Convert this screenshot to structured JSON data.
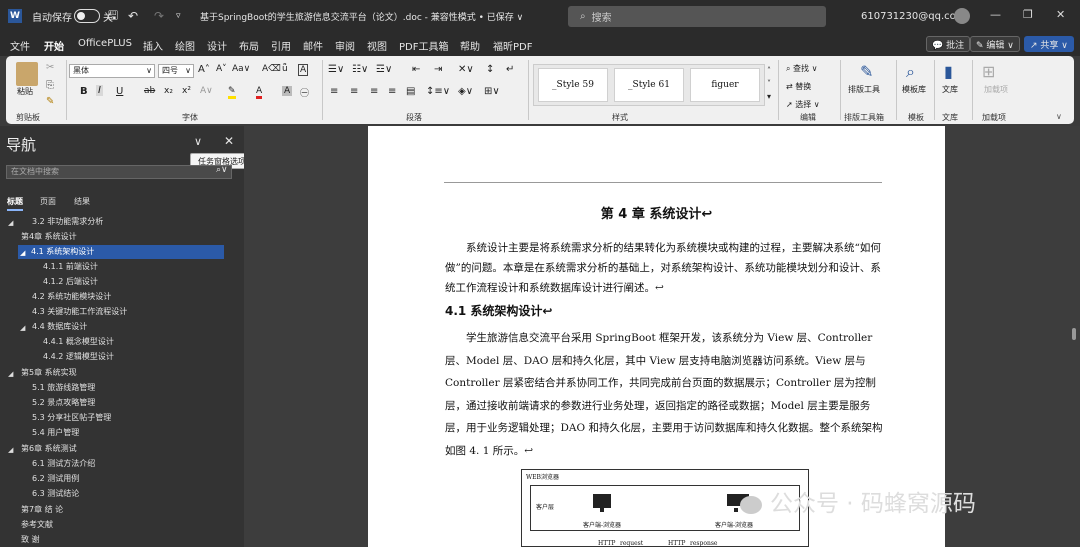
{
  "titlebar": {
    "autosave_label": "自动保存",
    "autosave_state": "关",
    "doc_title": "基于SpringBoot的学生旅游信息交流平台（论文）.doc  -  兼容性模式 • 已保存 ∨",
    "search_placeholder": "搜索",
    "account": "610731230@qq.com"
  },
  "menu": {
    "items": [
      "文件",
      "开始",
      "OfficePLUS",
      "插入",
      "绘图",
      "设计",
      "布局",
      "引用",
      "邮件",
      "审阅",
      "视图",
      "PDF工具箱",
      "帮助",
      "福昕PDF"
    ],
    "comment": "批注",
    "edit": "编辑",
    "share": "共享"
  },
  "ribbon": {
    "paste": "粘贴",
    "clipboard": "剪贴板",
    "font_name": "黑体",
    "font_size": "四号",
    "font_group": "字体",
    "paragraph_group": "段落",
    "styles": [
      "_Style 59",
      "_Style 61",
      "figuer"
    ],
    "styles_group": "样式",
    "find": "查找",
    "replace": "替换",
    "select": "选择",
    "editing_group": "编辑",
    "layout_tool": "排版工具",
    "layout_group": "排版工具箱",
    "template": "模板库",
    "template_group": "模板",
    "library": "文库",
    "library_group": "文库",
    "addins": "加载项",
    "addins_group": "加载项"
  },
  "nav": {
    "title": "导航",
    "search_placeholder": "在文档中搜索",
    "tooltip": "任务窗格选项",
    "tabs": [
      "标题",
      "页面",
      "结果"
    ],
    "items": [
      {
        "label": "3.2  非功能需求分析"
      },
      {
        "label": "第4章 系统设计"
      },
      {
        "label": "4.1  系统架构设计"
      },
      {
        "label": "4.1.1  前端设计"
      },
      {
        "label": "4.1.2  后端设计"
      },
      {
        "label": "4.2  系统功能模块设计"
      },
      {
        "label": "4.3  关键功能工作流程设计"
      },
      {
        "label": "4.4  数据库设计"
      },
      {
        "label": "4.4.1  概念模型设计"
      },
      {
        "label": "4.4.2  逻辑模型设计"
      },
      {
        "label": "第5章 系统实现"
      },
      {
        "label": "5.1  旅游线路管理"
      },
      {
        "label": "5.2  景点攻略管理"
      },
      {
        "label": "5.3  分享社区帖子管理"
      },
      {
        "label": "5.4  用户管理"
      },
      {
        "label": "第6章 系统测试"
      },
      {
        "label": "6.1  测试方法介绍"
      },
      {
        "label": "6.2  测试用例"
      },
      {
        "label": "6.3  测试结论"
      },
      {
        "label": "第7章  结    论"
      },
      {
        "label": "参考文献"
      },
      {
        "label": "致  谢"
      }
    ]
  },
  "doc": {
    "chapter_title": "第 4 章  系统设计↩",
    "intro": "系统设计主要是将系统需求分析的结果转化为系统模块或构建的过程，主要解决系统“如何做”的问题。本章是在系统需求分析的基础上，对系统架构设计、系统功能模块划分和设计、系统工作流程设计和系统数据库设计进行阐述。↩",
    "section_title": "4.1    系统架构设计↩",
    "body": "学生旅游信息交流平台采用  SpringBoot  框架开发，该系统分为 View 层、Controller 层、Model 层、DAO 层和持久化层，其中 View 层支持电脑浏览器访问系统。View 层与  Controller  层紧密结合并系协同工作，共同完成前台页面的数据展示；Controller 层为控制层，通过接收前端请求的参数进行业务处理，返回指定的路径或数据；Model 层主要是服务层，用于业务逻辑处理；DAO  和持久化层，主要用于访问数据库和持久化数据。整个系统架构如图 4. 1 所示。↩",
    "diagram": {
      "outer": "WEB浏览器",
      "client_layer": "客户层",
      "client1": "客户端-浏览器",
      "client2": "客户端-浏览器",
      "http1": "HTTP",
      "req": "request",
      "http2": "HTTP",
      "resp": "response"
    }
  },
  "watermark": "公众号 · 码蜂窝源码"
}
